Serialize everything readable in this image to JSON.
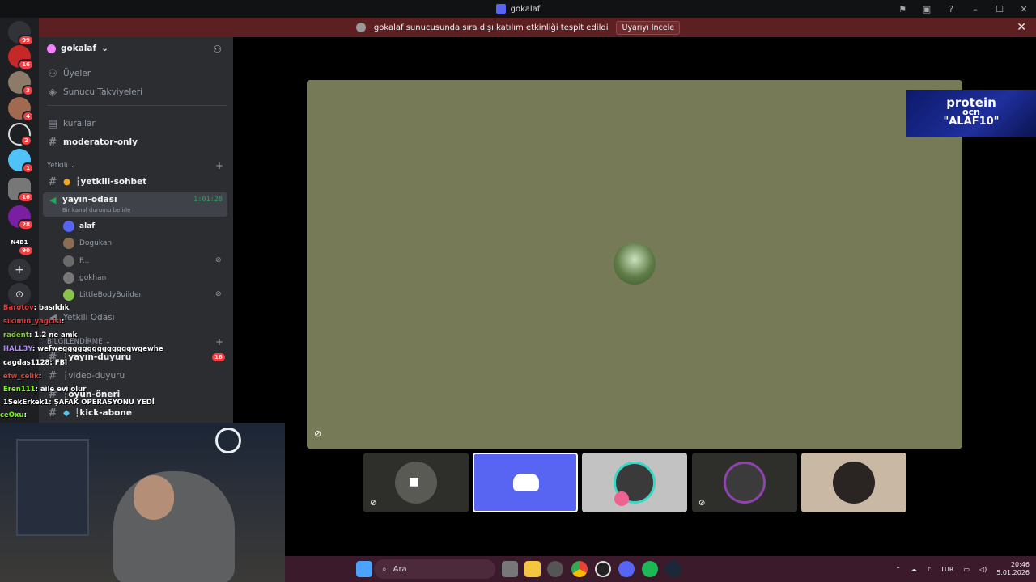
{
  "titlebar": {
    "title": "gokalaf"
  },
  "banner": {
    "message": "gokalaf sunucusunda sıra dışı katılım etkinliği tespit edildi",
    "button": "Uyarıyı İncele"
  },
  "servers": {
    "badges": [
      "99",
      "16",
      "3",
      "4",
      "2",
      "1",
      "16",
      "28",
      "90"
    ],
    "abbrev": "N4B1"
  },
  "server_header": {
    "name": "gokalaf"
  },
  "channels": {
    "members": "Üyeler",
    "boosts": "Sunucu Takviyeleri",
    "rules": "kurallar",
    "mod_only": "moderator-only",
    "cat_staff": "Yetkili",
    "staff_chat": "┆yetkili-sohbet",
    "stream_room": "yayın-odası",
    "stream_time": "1:01:28",
    "status_hint": "Bir kanal durumu belirle",
    "voice_users": [
      "alaf",
      "Dogukan",
      "F...",
      "gokhan",
      "LittleBodyBuilder"
    ],
    "staff_room": "Yetkili Odası",
    "cat_info": "BİLGİLENDİRME",
    "announce": "┆yayın-duyuru",
    "announce_badge": "16",
    "video_announce": "┆video-duyuru",
    "game_suggest": "┆oyun-öneri",
    "kick_follow": "┆kick-abone"
  },
  "chat": [
    {
      "user": "Barotov",
      "text": ": basıldık",
      "color": "#e53935"
    },
    {
      "user": "sikimin_yagcisi",
      "text": ":",
      "color": "#e53935"
    },
    {
      "user": "radent",
      "text": ": 1.2 ne amk",
      "color": "#8bc34a"
    },
    {
      "user": "HALL3Y",
      "text": ": wefwegggggggggggggqwgewhe",
      "color": "#b388ff"
    },
    {
      "user": "cagdas1128",
      "text": ": FBI",
      "color": "#ffffff"
    },
    {
      "user": "efw_celik",
      "text": ":",
      "color": "#e53935"
    },
    {
      "user": "Eren111",
      "text": ": aile evi olur",
      "color": "#76ff03"
    },
    {
      "user": "1SekErkek1",
      "text": ": ŞAFAK OPERASYONU YEDİ",
      "color": "#ffffff"
    },
    {
      "user": "ceOxu",
      "text": ":",
      "color": "#76ff03"
    }
  ],
  "promo": {
    "line1": "protein",
    "line2": "ocn",
    "line3": "\"ALAF10\""
  },
  "taskbar": {
    "search": "Ara",
    "lang": "TUR",
    "time": "20:46",
    "date": "5.01.2026"
  }
}
